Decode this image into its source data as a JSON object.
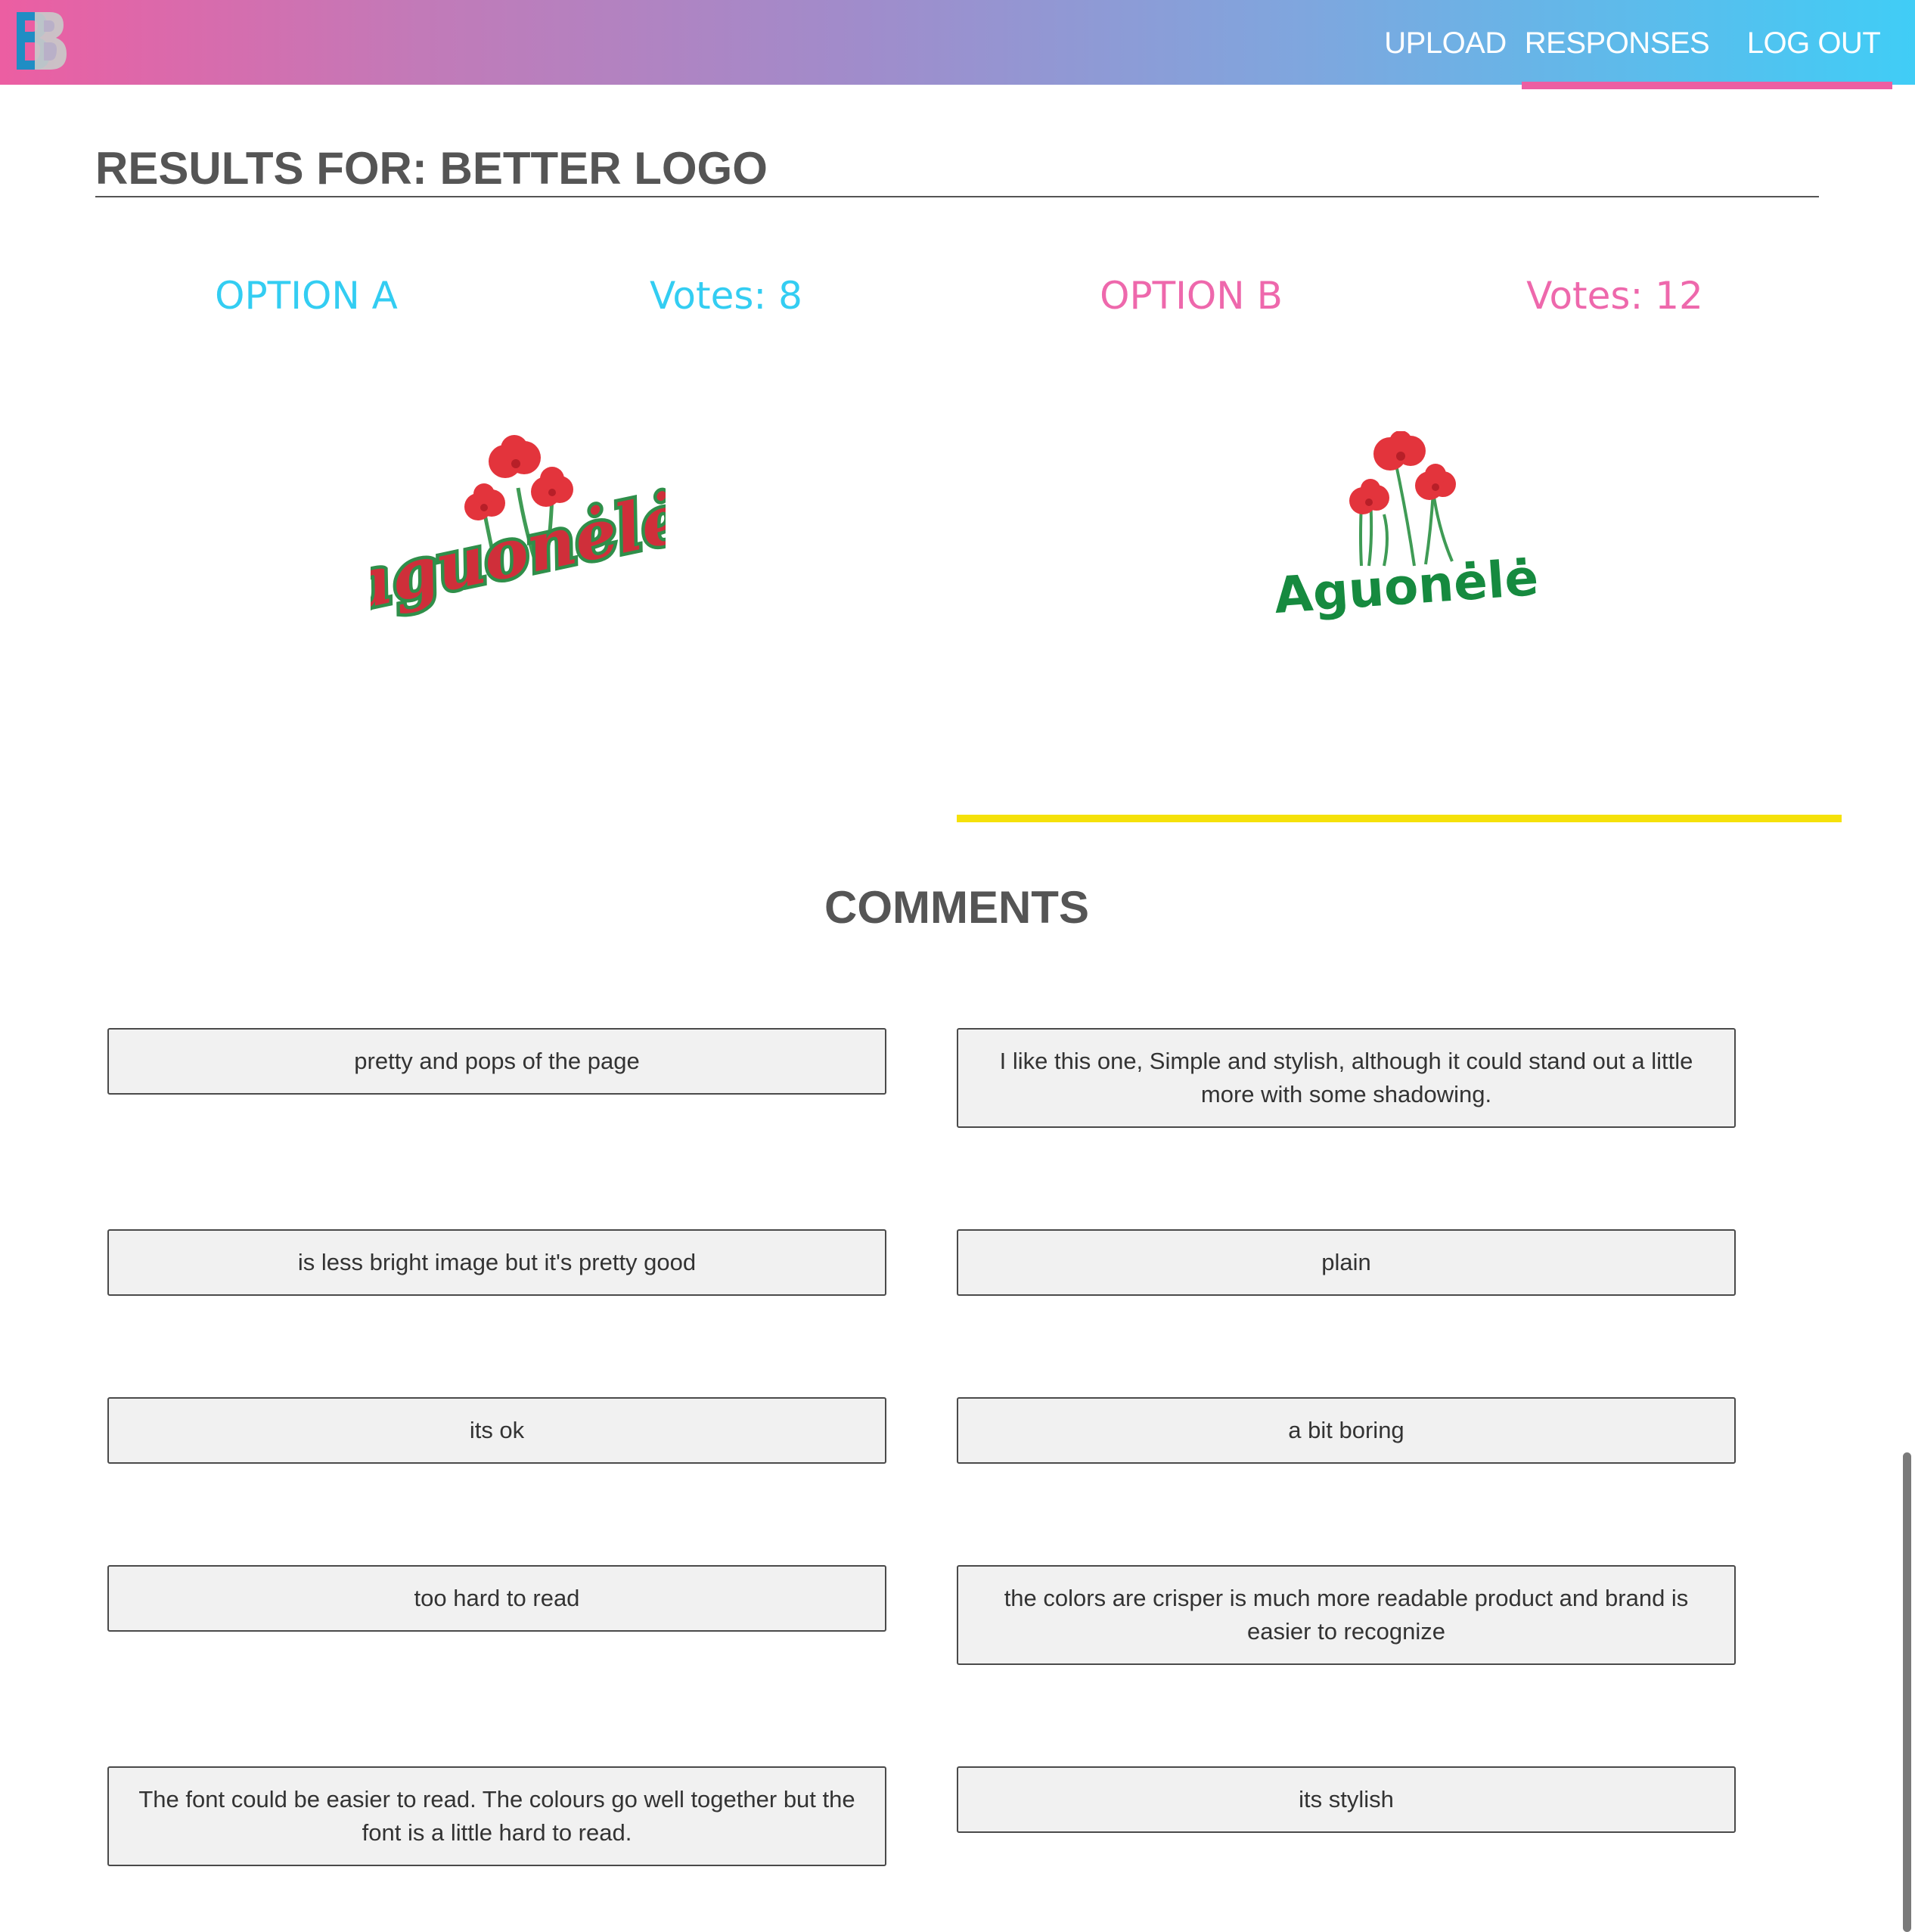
{
  "nav": {
    "brand": "BB",
    "items": [
      {
        "label": "UPLOAD"
      },
      {
        "label": "RESPONSES"
      },
      {
        "label": "LOG OUT"
      }
    ],
    "active": "RESPONSES"
  },
  "results": {
    "title": "RESULTS FOR: BETTER LOGO"
  },
  "options": {
    "a": {
      "label": "OPTION A",
      "votes_text": "Votes: 8",
      "votes": 8,
      "logo_text": "aguonėlė",
      "color": "#33cdf2"
    },
    "b": {
      "label": "OPTION B",
      "votes_text": "Votes: 12",
      "votes": 12,
      "logo_text": "Aguonėlė",
      "color": "#ee68ac"
    },
    "winner": "b",
    "winner_bar_color": "#f5e10a"
  },
  "comments": {
    "title": "COMMENTS",
    "option_a": [
      "pretty and pops of the page",
      "is less bright image but it's pretty good",
      "its ok",
      "too hard to read",
      "The font could be easier to read. The colours go well together but the font is a little hard to read."
    ],
    "option_b": [
      "I like this one, Simple and stylish, although it could stand out a little more with some shadowing.",
      "plain",
      "a bit boring",
      "the colors are crisper is much more readable product and brand is easier to recognize",
      "its stylish"
    ]
  },
  "colors": {
    "nav_gradient_start": "#ec5ea2",
    "nav_gradient_end": "#40cdf6",
    "active_underline": "#ec5ea2",
    "heading": "#555555"
  }
}
